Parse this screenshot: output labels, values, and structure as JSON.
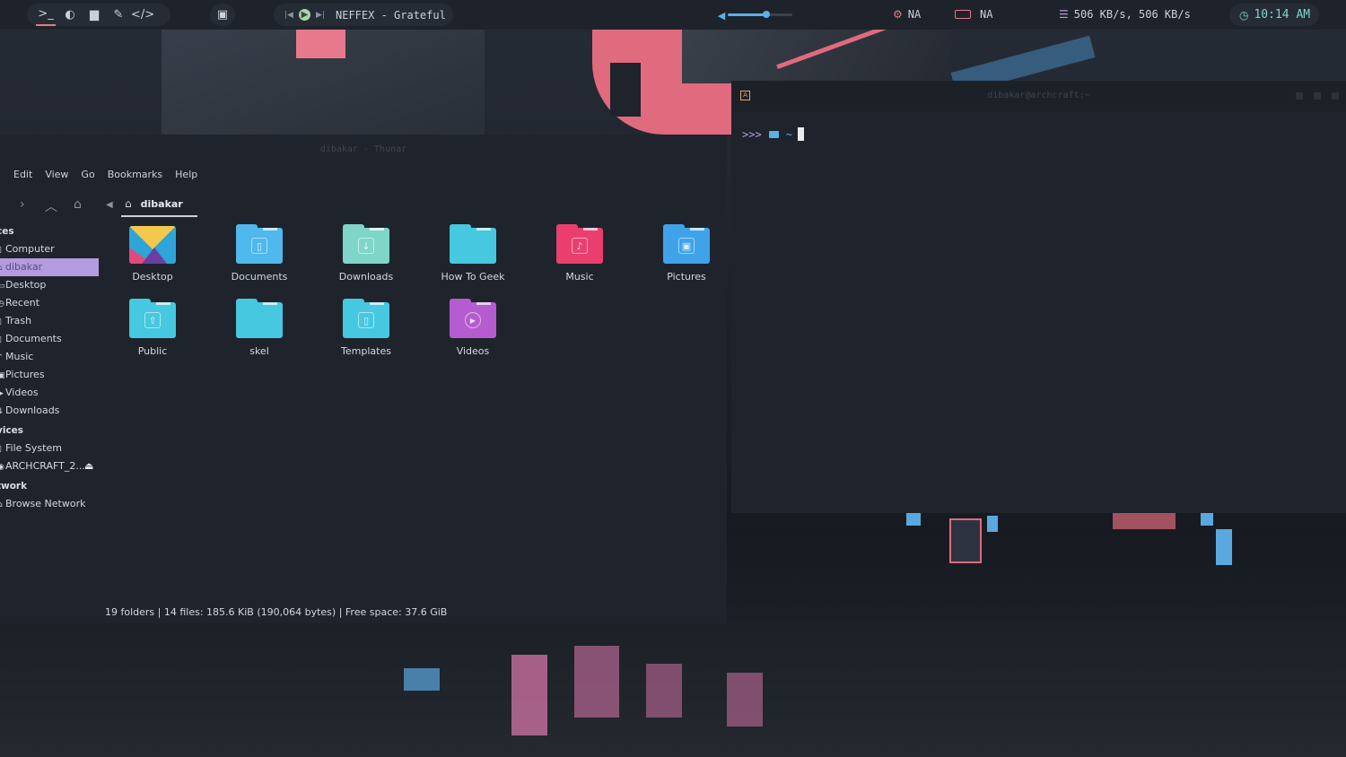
{
  "topbar": {
    "media_title": "NEFFEX - Grateful",
    "cpu_temp": "NA",
    "battery": "NA",
    "network": "506 KB/s, 506 KB/s",
    "clock": "10:14 AM",
    "volume_fraction": 0.6,
    "accent": "#e8f0f5"
  },
  "thunar": {
    "title": "dibakar - Thunar",
    "menu": [
      "Edit",
      "View",
      "Go",
      "Bookmarks",
      "Help"
    ],
    "path_label": "dibakar",
    "sidebar": {
      "places_header": "ces",
      "places": [
        "Computer",
        "dibakar",
        "Desktop",
        "Recent",
        "Trash",
        "Documents",
        "Music",
        "Pictures",
        "Videos",
        "Downloads"
      ],
      "devices_header": "vices",
      "devices": [
        "File System",
        "ARCHCRAFT_2..."
      ],
      "network_header": "twork",
      "network": [
        "Browse Network"
      ]
    },
    "files": [
      {
        "label": "Desktop",
        "color": "#2ea4d9",
        "icon": "desktop-icon"
      },
      {
        "label": "Documents",
        "color": "#4fb8ec",
        "icon": "document-icon"
      },
      {
        "label": "Downloads",
        "color": "#7fd6c8",
        "icon": "download-icon"
      },
      {
        "label": "How To Geek",
        "color": "#45c8e0",
        "icon": "folder-icon"
      },
      {
        "label": "Music",
        "color": "#ea3f6e",
        "icon": "music-icon"
      },
      {
        "label": "Pictures",
        "color": "#3fa3ea",
        "icon": "picture-icon"
      },
      {
        "label": "Public",
        "color": "#45c8e0",
        "icon": "share-icon"
      },
      {
        "label": "skel",
        "color": "#45c8e0",
        "icon": "folder-icon"
      },
      {
        "label": "Templates",
        "color": "#45c8e0",
        "icon": "template-icon"
      },
      {
        "label": "Videos",
        "color": "#b55cd0",
        "icon": "video-icon"
      }
    ],
    "status": "19 folders  |  14 files: 185.6 KiB (190,064 bytes)  |  Free space: 37.6 GiB"
  },
  "terminal": {
    "title": "dibakar@archcraft:~",
    "prompt_arrows": ">>>",
    "prompt_dir": "~"
  }
}
